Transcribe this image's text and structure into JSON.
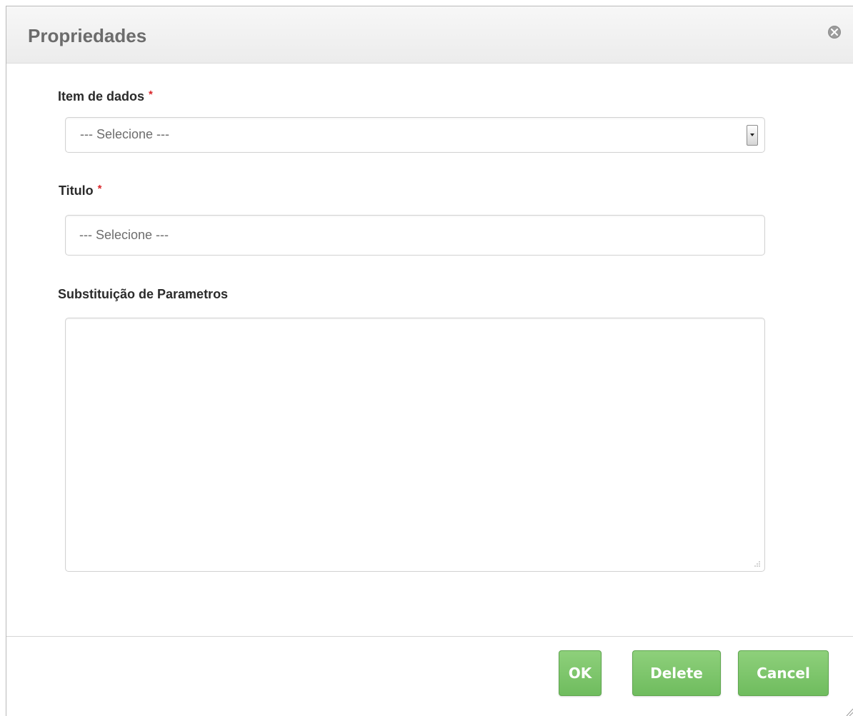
{
  "dialog": {
    "title": "Propriedades"
  },
  "fields": {
    "item_de_dados": {
      "label": "Item de dados",
      "required_mark": "*",
      "selected": "--- Selecione ---"
    },
    "titulo": {
      "label": "Titulo",
      "required_mark": "*",
      "placeholder": "--- Selecione ---"
    },
    "substituicao": {
      "label": "Substituição de Parametros",
      "value": ""
    }
  },
  "buttons": {
    "ok": "OK",
    "delete": "Delete",
    "cancel": "Cancel"
  },
  "icons": {
    "close": "close-icon",
    "dropdown": "chevron-down-icon",
    "resize": "resize-grip-icon"
  },
  "colors": {
    "button_green": "#7cc66a",
    "required_red": "#d9262a",
    "title_gray": "#6c6c6c"
  }
}
